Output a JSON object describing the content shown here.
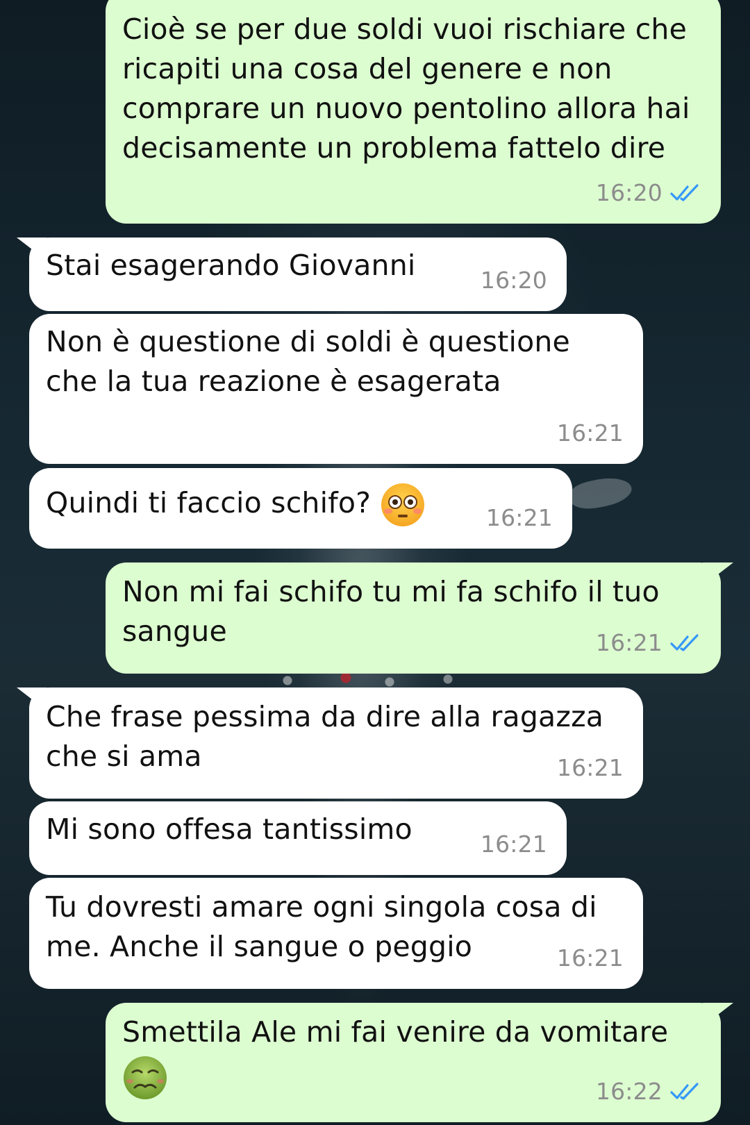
{
  "messages": [
    {
      "direction": "out",
      "text": "Cioè se per due soldi vuoi rischiare che ricapiti una cosa del genere e non comprare un nuovo pentolino allora hai decisamente un problema fattelo dire",
      "time": "16:20",
      "status_icon": "double-check-read-icon"
    },
    {
      "direction": "in",
      "text": "Stai esagerando Giovanni",
      "time": "16:20"
    },
    {
      "direction": "in",
      "text": "Non è questione di soldi è questione che la tua reazione è esagerata",
      "time": "16:21"
    },
    {
      "direction": "in",
      "text": "Quindi ti faccio schifo?",
      "emoji": "flushed-face-emoji",
      "time": "16:21"
    },
    {
      "direction": "out",
      "text": "Non mi fai schifo tu mi fa schifo il tuo sangue",
      "time": "16:21",
      "status_icon": "double-check-read-icon"
    },
    {
      "direction": "in",
      "text": "Che frase pessima da dire alla ragazza che si ama",
      "time": "16:21"
    },
    {
      "direction": "in",
      "text": "Mi sono offesa tantissimo",
      "time": "16:21"
    },
    {
      "direction": "in",
      "text": "Tu dovresti amare ogni singola cosa di me. Anche il sangue o peggio",
      "time": "16:21"
    },
    {
      "direction": "out",
      "text": "Smettila Ale mi fai venire da vomitare",
      "emoji": "nauseated-face-emoji",
      "time": "16:22",
      "status_icon": "double-check-read-icon"
    }
  ],
  "colors": {
    "incoming_bubble": "#ffffff",
    "outgoing_bubble": "#dcfdd0",
    "timestamp": "#8c8c8c",
    "read_check": "#3497f9"
  }
}
